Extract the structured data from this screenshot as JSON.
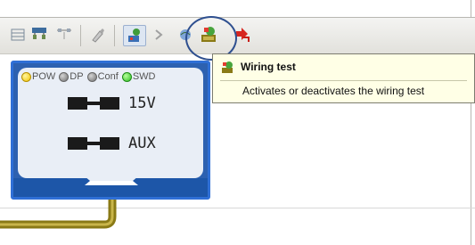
{
  "toolbar": {
    "icons": [
      "toolbar-grid-icon",
      "toolbar-network-icon",
      "toolbar-split-icon",
      "toolbar-brush-icon",
      "toolbar-module-icon",
      "toolbar-arrow-icon",
      "toolbar-globe-icon",
      "wiring-test-icon",
      "connect-icon"
    ]
  },
  "tooltip": {
    "title": "Wiring test",
    "description": "Activates or deactivates the wiring test"
  },
  "module": {
    "leds": [
      {
        "label": "POW",
        "color": "#f2c500"
      },
      {
        "label": "DP",
        "color": "#808080"
      },
      {
        "label": "Conf",
        "color": "#808080"
      },
      {
        "label": "SWD",
        "color": "#2fbf22"
      }
    ],
    "connectors": [
      {
        "label": "15V"
      },
      {
        "label": "AUX"
      }
    ]
  },
  "colors": {
    "module_border": "#2f6fd6",
    "module_fill": "#2d61b0",
    "cable": "#8a7a16",
    "tooltip_bg": "#ffffe6"
  }
}
